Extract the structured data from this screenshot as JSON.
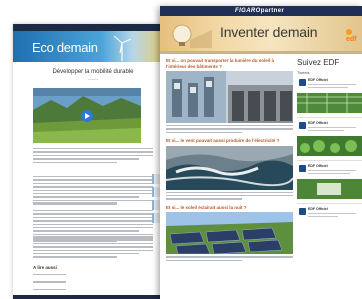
{
  "back_page": {
    "brand": "",
    "banner_text": "Eco demain",
    "heading": "Développer la mobilité durable",
    "related_title": "A lire aussi"
  },
  "front_page": {
    "brand_prefix": "FIGARO",
    "brand_suffix": "partner",
    "banner_text": "Inventer demain",
    "banner_logo": "edf",
    "questions": [
      {
        "title": "Et si... on pouvait transporter la lumière du soleil à l'intérieur des bâtiments ?"
      },
      {
        "title": "Et si... le vent pouvait aussi produire de l'électricité ?"
      },
      {
        "title": "Et si... le soleil éclairait aussi la nuit ?"
      }
    ],
    "sidebar": {
      "title": "Suivez EDF",
      "tweets_label": "Tweets",
      "tweet_author": "EDF Officiel"
    }
  },
  "colors": {
    "front_topbar": "#1f2f55",
    "question_title": "#b85a2a",
    "edf_orange": "#ff7a00"
  }
}
